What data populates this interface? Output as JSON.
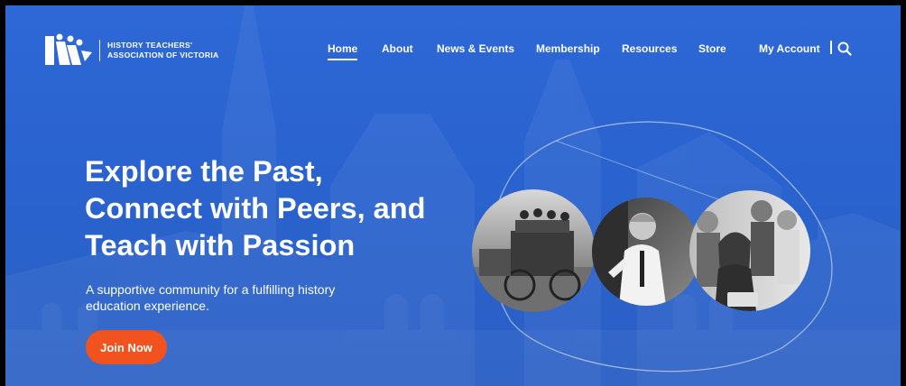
{
  "site": {
    "name_line1": "HISTORY TEACHERS'",
    "name_line2": "ASSOCIATION OF VICTORIA"
  },
  "nav": {
    "items": [
      {
        "label": "Home",
        "active": true
      },
      {
        "label": "About",
        "active": false
      },
      {
        "label": "News & Events",
        "active": false
      },
      {
        "label": "Membership",
        "active": false
      },
      {
        "label": "Resources",
        "active": false
      },
      {
        "label": "Store",
        "active": false
      },
      {
        "label": "My Account",
        "active": false
      }
    ],
    "search_icon": "search-icon"
  },
  "hero": {
    "title_lines": [
      "Explore the Past,",
      "Connect with Peers, and",
      "Teach with Passion"
    ],
    "subtitle": "A supportive community for a fulfilling history education experience.",
    "cta_label": "Join Now"
  },
  "images": [
    {
      "subject": "historic-stagecoach-photo"
    },
    {
      "subject": "teacher-presenting-photo"
    },
    {
      "subject": "students-with-tablet-photo"
    }
  ],
  "colors": {
    "background": "#2b64d0",
    "cta": "#f2521e",
    "text": "#ffffff",
    "frame": "#000000"
  }
}
